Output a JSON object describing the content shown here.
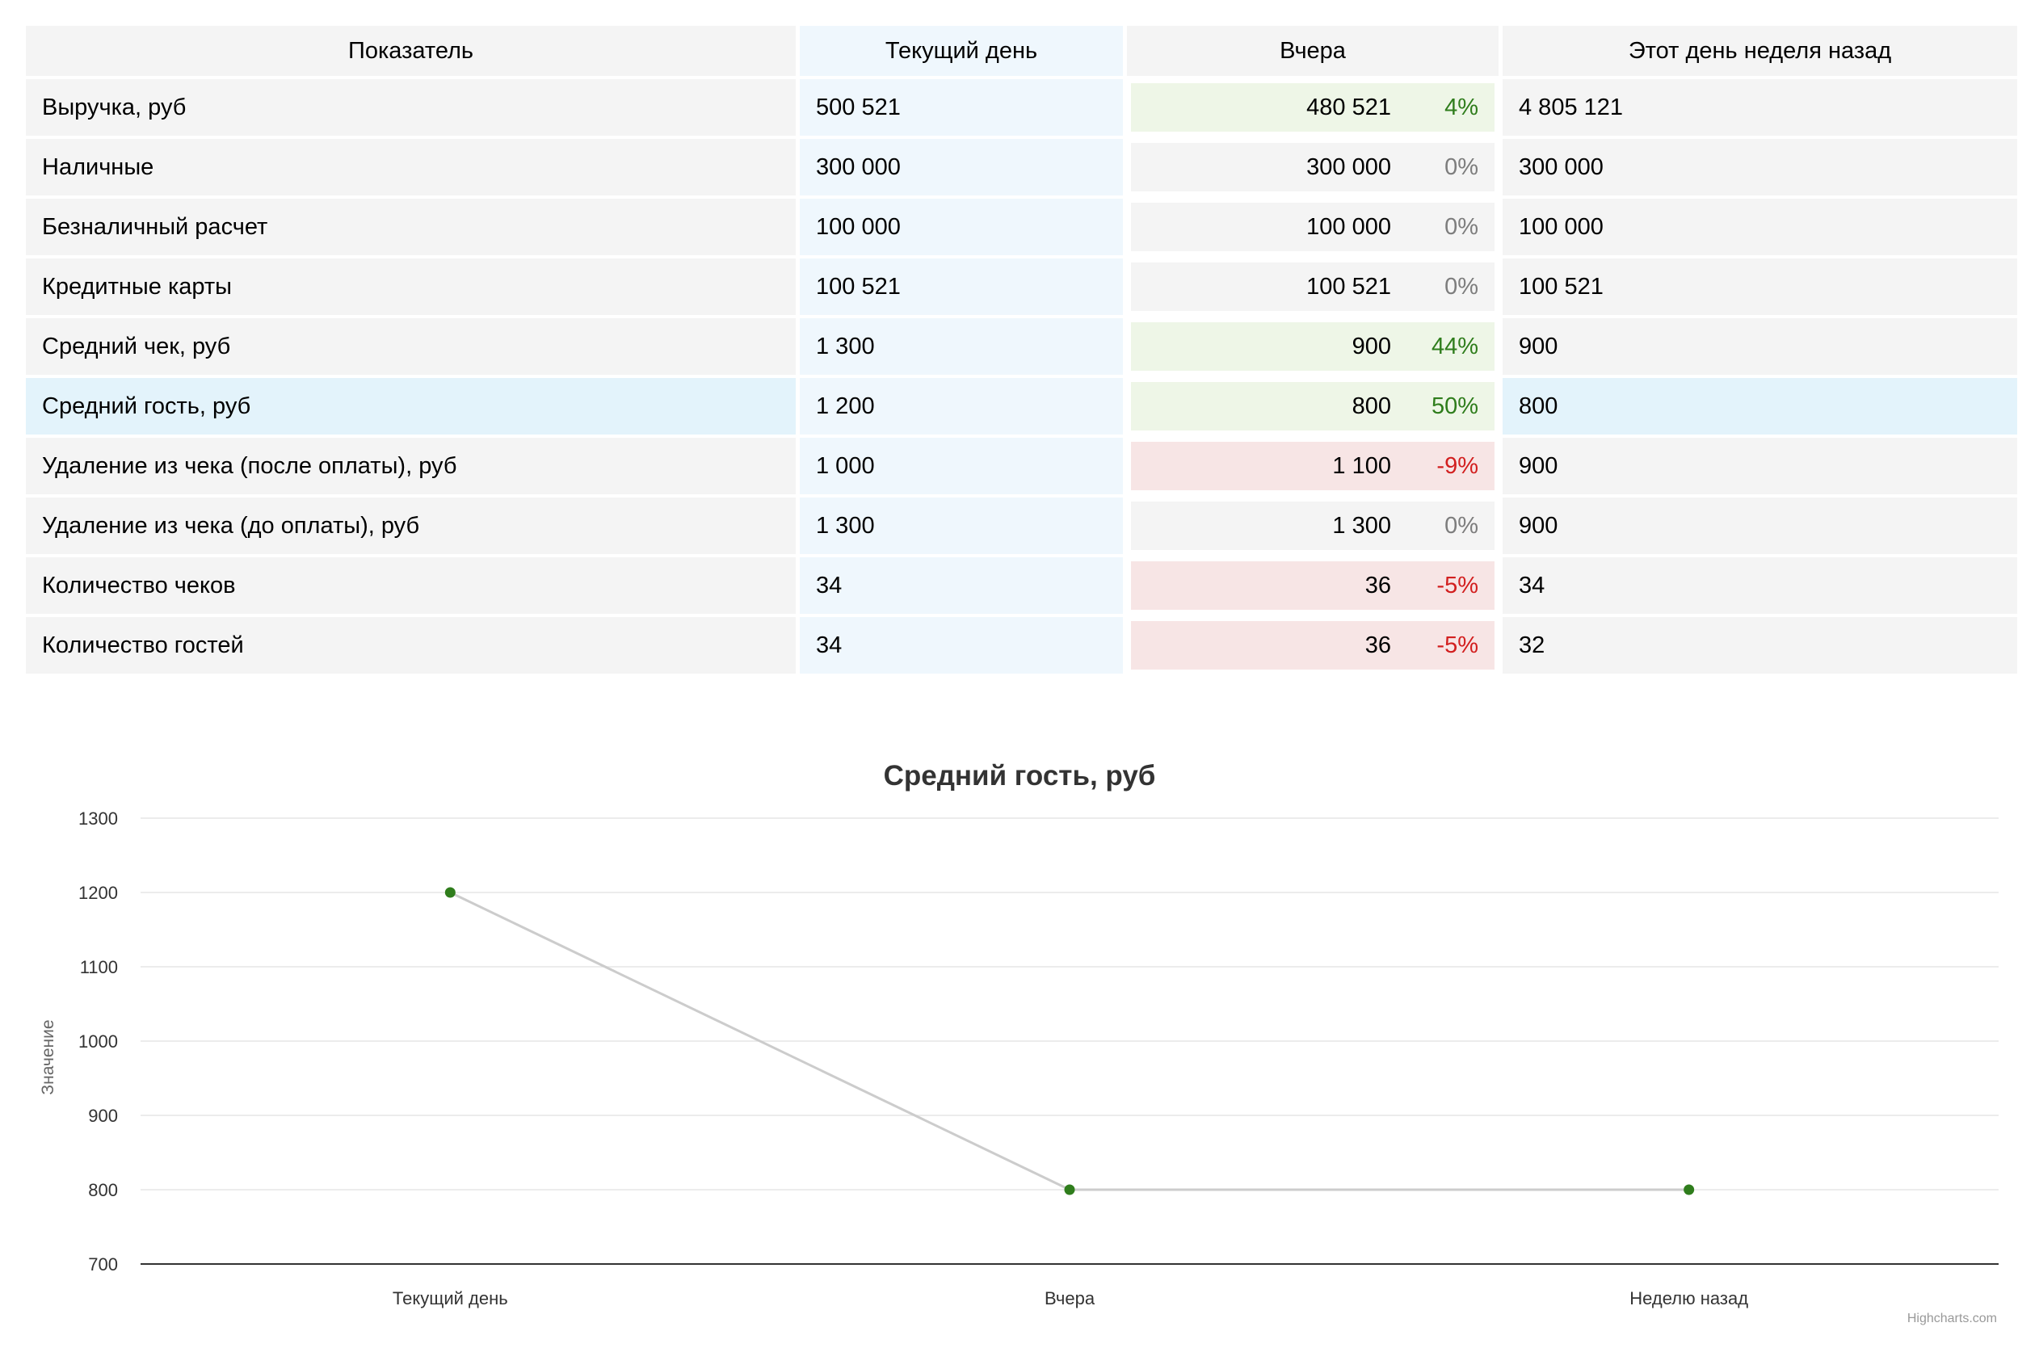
{
  "table": {
    "headers": [
      "Показатель",
      "Текущий день",
      "Вчера",
      "Этот день неделя назад"
    ],
    "rows": [
      {
        "name": "Выручка, руб",
        "current": "500 521",
        "yesterday": "480 521",
        "change": "4%",
        "trend": "up",
        "week_ago": "4 805 121"
      },
      {
        "name": "Наличные",
        "current": "300 000",
        "yesterday": "300 000",
        "change": "0%",
        "trend": "flat",
        "week_ago": "300 000"
      },
      {
        "name": "Безналичный расчет",
        "current": "100 000",
        "yesterday": "100 000",
        "change": "0%",
        "trend": "flat",
        "week_ago": "100 000"
      },
      {
        "name": "Кредитные карты",
        "current": "100 521",
        "yesterday": "100 521",
        "change": "0%",
        "trend": "flat",
        "week_ago": "100 521"
      },
      {
        "name": "Средний чек, руб",
        "current": "1 300",
        "yesterday": "900",
        "change": "44%",
        "trend": "up",
        "week_ago": "900"
      },
      {
        "name": "Средний гость, руб",
        "current": "1 200",
        "yesterday": "800",
        "change": "50%",
        "trend": "up",
        "week_ago": "800",
        "highlighted": true
      },
      {
        "name": "Удаление из чека (после оплаты), руб",
        "current": "1 000",
        "yesterday": "1 100",
        "change": "-9%",
        "trend": "down",
        "week_ago": "900"
      },
      {
        "name": "Удаление из чека (до оплаты), руб",
        "current": "1 300",
        "yesterday": "1 300",
        "change": "0%",
        "trend": "flat",
        "week_ago": "900"
      },
      {
        "name": "Количество чеков",
        "current": "34",
        "yesterday": "36",
        "change": "-5%",
        "trend": "down",
        "week_ago": "34"
      },
      {
        "name": "Количество гостей",
        "current": "34",
        "yesterday": "36",
        "change": "-5%",
        "trend": "down",
        "week_ago": "32"
      }
    ]
  },
  "chart_data": {
    "type": "line",
    "title": "Средний гость, руб",
    "ylabel": "Значение",
    "categories": [
      "Текущий день",
      "Вчера",
      "Неделю назад"
    ],
    "values": [
      1200,
      800,
      800
    ],
    "ylim": [
      700,
      1300
    ],
    "yticks": [
      700,
      800,
      900,
      1000,
      1100,
      1200,
      1300
    ],
    "grid": true,
    "line_color": "#cccccc",
    "marker_color": "#2f7d1c",
    "credits": "Highcharts.com"
  },
  "colors": {
    "up": "#2f7d1c",
    "down": "#d21f1f",
    "flat": "#7d7d7d"
  }
}
